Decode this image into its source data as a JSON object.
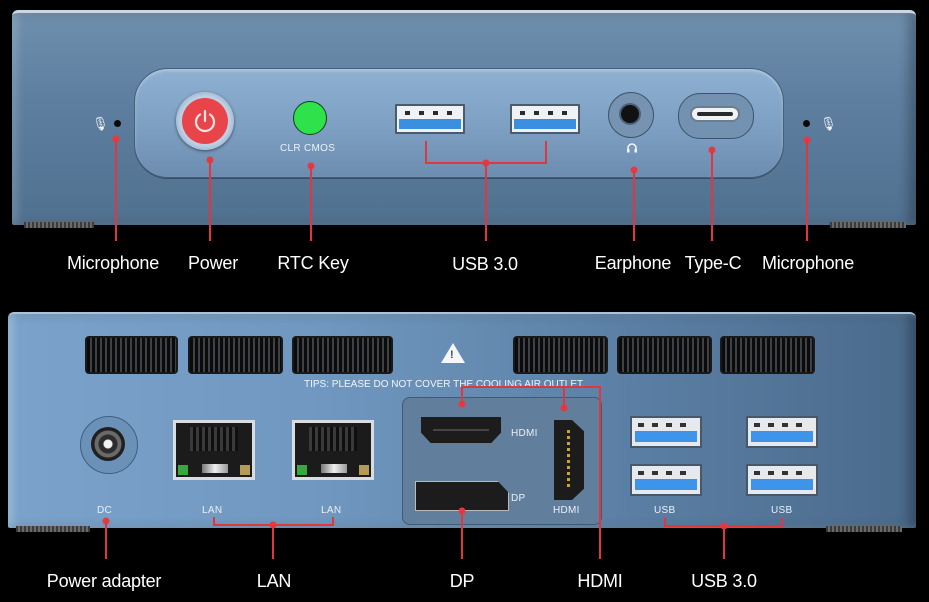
{
  "front_panel": {
    "clr_cmos_label": "CLR  CMOS",
    "icons": {
      "mic_left": "microphone-icon",
      "power": "power-icon",
      "earphone": "headset-icon",
      "mic_right": "microphone-icon"
    },
    "callouts": [
      {
        "id": "microphone-left",
        "label": "Microphone"
      },
      {
        "id": "power",
        "label": "Power"
      },
      {
        "id": "rtc-key",
        "label": "RTC Key"
      },
      {
        "id": "usb-front",
        "label": "USB 3.0"
      },
      {
        "id": "earphone",
        "label": "Earphone"
      },
      {
        "id": "type-c",
        "label": "Type-C"
      },
      {
        "id": "microphone-right",
        "label": "Microphone"
      }
    ]
  },
  "rear_panel": {
    "tips": "TIPS: PLEASE DO NOT COVER THE COOLING AIR OUTLET.",
    "warning_icon": "warning-triangle-icon",
    "port_labels": {
      "dc": "DC",
      "lan1": "LAN",
      "lan2": "LAN",
      "hdmi_horizontal": "HDMI",
      "dp": "DP",
      "hdmi_vertical": "HDMI",
      "usb_left": "USB",
      "usb_right": "USB"
    },
    "callouts": [
      {
        "id": "power-adapter",
        "label": "Power adapter"
      },
      {
        "id": "lan",
        "label": "LAN"
      },
      {
        "id": "dp",
        "label": "DP"
      },
      {
        "id": "hdmi",
        "label": "HDMI"
      },
      {
        "id": "usb-rear",
        "label": "USB 3.0"
      }
    ]
  },
  "colors": {
    "leader_line": "#e2363d",
    "power_button": "#e8444a",
    "rtc_button": "#2fe14a",
    "usb_blue": "#3b8fe0",
    "chassis_blue": "#6f8fae"
  }
}
